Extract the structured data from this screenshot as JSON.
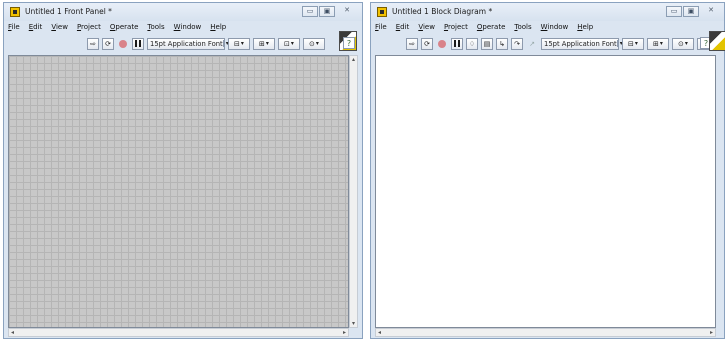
{
  "front_panel": {
    "title": "Untitled 1 Front Panel *",
    "menu": [
      "File",
      "Edit",
      "View",
      "Project",
      "Operate",
      "Tools",
      "Window",
      "Help"
    ],
    "font_select": "15pt Application Font",
    "toolbar_icons": [
      "run-arrow-icon",
      "run-continuous-icon",
      "abort-icon",
      "pause-icon",
      "align-icon",
      "distribute-icon",
      "resize-icon",
      "reorder-icon"
    ],
    "help_label": "?"
  },
  "block_diagram": {
    "title": "Untitled 1 Block Diagram *",
    "menu": [
      "File",
      "Edit",
      "View",
      "Project",
      "Operate",
      "Tools",
      "Window",
      "Help"
    ],
    "font_select": "15pt Application Font",
    "toolbar_icons": [
      "run-arrow-icon",
      "run-continuous-icon",
      "abort-icon",
      "pause-icon",
      "highlight-execution-icon",
      "retain-wire-values-icon",
      "step-into-icon",
      "step-over-icon",
      "align-icon",
      "distribute-icon",
      "reorder-icon",
      "cleanup-diagram-icon"
    ],
    "help_label": "?"
  },
  "window_buttons": {
    "minimize": "▭",
    "maximize": "▣",
    "close": "✕"
  },
  "colors": {
    "grid_background": "#c8c8c8",
    "grid_line": "#b5b5b5",
    "window_frame": "#dbe5f1",
    "diagram_background": "#ffffff"
  }
}
